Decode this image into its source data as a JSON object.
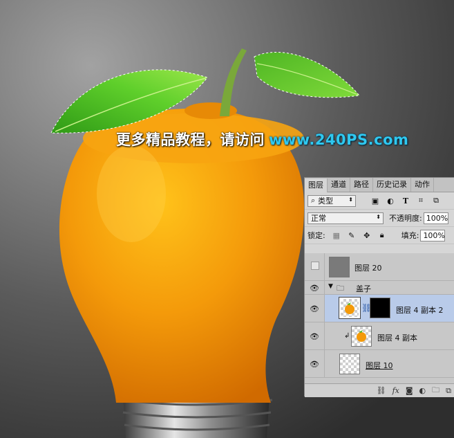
{
  "watermark": {
    "text_cn": "更多精品教程，请访问",
    "url": "www.240PS.com"
  },
  "layers_panel": {
    "tabs": [
      {
        "label": "图层",
        "active": true
      },
      {
        "label": "通道"
      },
      {
        "label": "路径"
      },
      {
        "label": "历史记录"
      },
      {
        "label": "动作"
      }
    ],
    "filter_kind": "类型",
    "blend_mode": "正常",
    "opacity_label": "不透明度:",
    "opacity_value": "100%",
    "lock_label": "锁定:",
    "fill_label": "填充:",
    "fill_value": "100%",
    "layers": [
      {
        "name": "图层 20",
        "visible": false,
        "thumb": "gray"
      },
      {
        "name": "盖子",
        "visible": true,
        "type": "group",
        "expanded": true
      },
      {
        "name": "图层 4 副本 2",
        "visible": true,
        "selected": true,
        "has_mask": true,
        "smart_object": true
      },
      {
        "name": "图层 4 副本",
        "visible": true,
        "clipped": true,
        "smart_object": true
      },
      {
        "name": "图层 10",
        "visible": true
      }
    ]
  },
  "colors": {
    "panel_bg": "#d6d6d6",
    "selected_row": "#b9cbe9",
    "watermark_url": "#2fc8f0"
  }
}
